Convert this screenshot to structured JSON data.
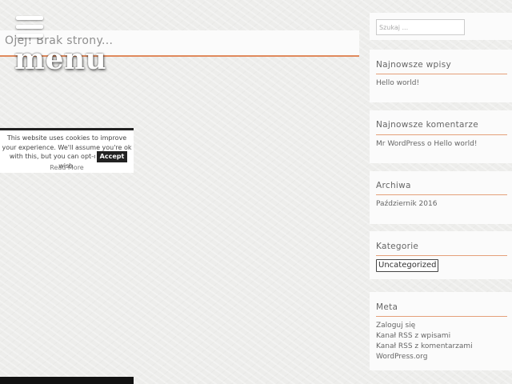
{
  "main": {
    "page_title": "Ojej! Brak strony...",
    "menu_label": "menu"
  },
  "cookie_notice": {
    "text": "This website uses cookies to improve your experience. We'll assume you're ok with this, but you can opt-out if you wish.",
    "accept_label": "Accept",
    "read_more_label": "Read More"
  },
  "sidebar": {
    "search": {
      "placeholder": "Szukaj ..."
    },
    "recent_posts": {
      "title": "Najnowsze wpisy",
      "items": [
        "Hello world!"
      ]
    },
    "recent_comments": {
      "title": "Najnowsze komentarze",
      "items": [
        "Mr WordPress o Hello world!"
      ]
    },
    "archives": {
      "title": "Archiwa",
      "items": [
        "Październik 2016"
      ]
    },
    "categories": {
      "title": "Kategorie",
      "items": [
        "Uncategorized"
      ]
    },
    "meta": {
      "title": "Meta",
      "items": [
        "Zaloguj się",
        "Kanał RSS z wpisami",
        "Kanał RSS z komentarzami",
        "WordPress.org"
      ]
    }
  },
  "colors": {
    "accent_rule": "#e08a5d",
    "background": "#ededeb"
  },
  "icons": {
    "menu_toggle": "hamburger-icon"
  }
}
